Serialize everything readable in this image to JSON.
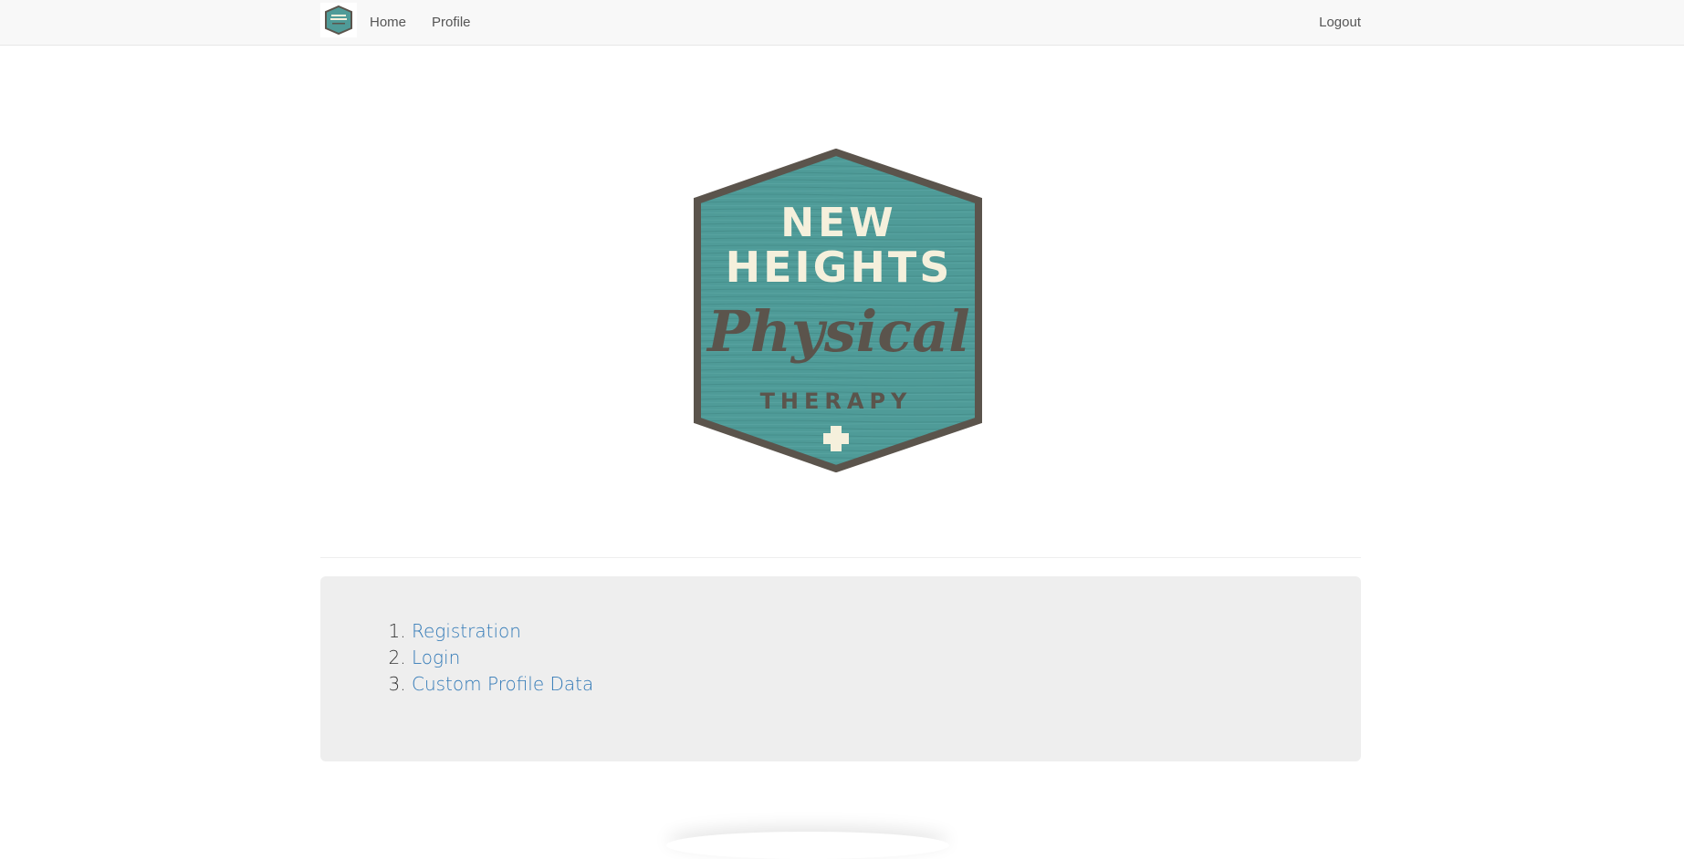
{
  "navbar": {
    "brand_logo_icon": "new-heights-badge-icon",
    "home_label": "Home",
    "profile_label": "Profile",
    "logout_label": "Logout"
  },
  "logo": {
    "line1": "NEW",
    "line2": "HEIGHTS",
    "line3": "Physical",
    "line4": "THERAPY",
    "icon": "medical-cross-icon"
  },
  "links": [
    {
      "label": "Registration"
    },
    {
      "label": "Login"
    },
    {
      "label": "Custom Profile Data"
    }
  ],
  "colors": {
    "teal": "#4f9b98",
    "border": "#5b544c",
    "cream": "#f5f0dc",
    "link": "#337ab7"
  }
}
